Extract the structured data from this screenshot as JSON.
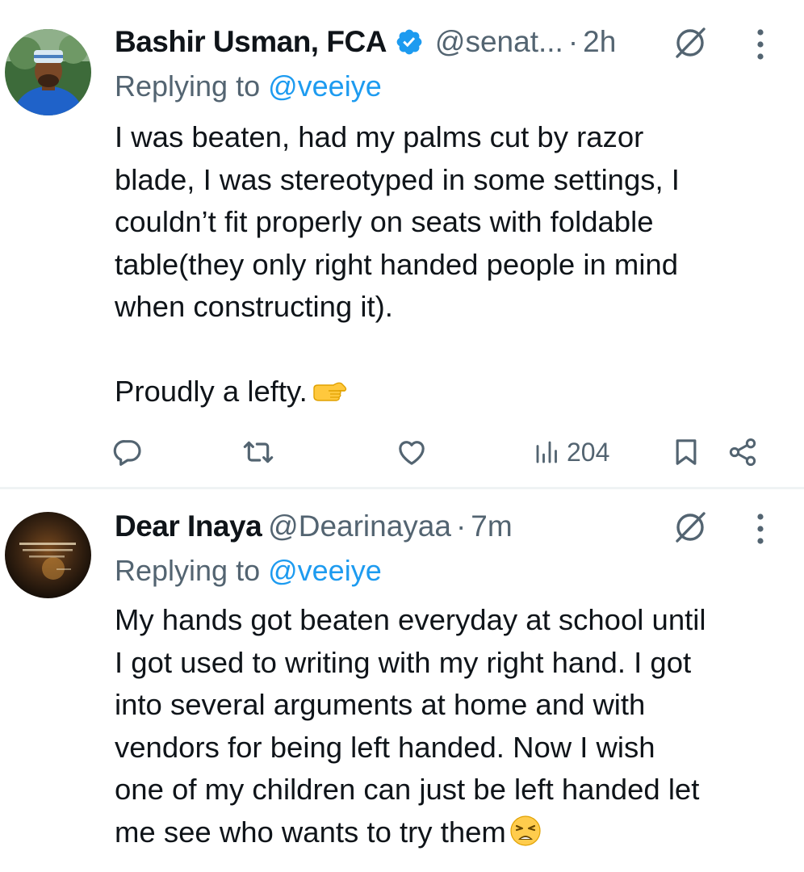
{
  "tweets": [
    {
      "author_name": "Bashir Usman, FCA",
      "verified": true,
      "handle": "@senat...",
      "separator": "·",
      "time": "2h",
      "replying_prefix": "Replying to ",
      "replying_to": "@veeiye",
      "body_lines": [
        "I was beaten, had my palms cut by razor",
        "blade, I was stereotyped in some settings, I",
        "couldn’t fit properly on seats with foldable",
        "table(they only right handed people in mind",
        "when constructing it).",
        "",
        "Proudly a lefty."
      ],
      "trailing_emoji": "backhand-index-pointing-right",
      "views": "204"
    },
    {
      "author_name": "Dear Inaya",
      "verified": false,
      "handle": "@Dearinayaa",
      "separator": "·",
      "time": "7m",
      "replying_prefix": "Replying to ",
      "replying_to": "@veeiye",
      "body_lines": [
        "My hands got beaten everyday at school until",
        "I got used to writing with my right hand. I got",
        "into several arguments at home and with",
        "vendors for being left handed. Now I wish",
        "one of my children can just be left handed let",
        "me see who wants to try them"
      ],
      "trailing_emoji": "weary-face"
    }
  ],
  "colors": {
    "text_primary": "#0f1419",
    "text_secondary": "#536471",
    "accent": "#1d9bf0",
    "divider": "#eff3f4"
  },
  "icons": [
    "grok-icon",
    "more-icon",
    "reply-icon",
    "retweet-icon",
    "like-icon",
    "views-icon",
    "bookmark-icon",
    "share-icon",
    "verified-badge-icon"
  ]
}
